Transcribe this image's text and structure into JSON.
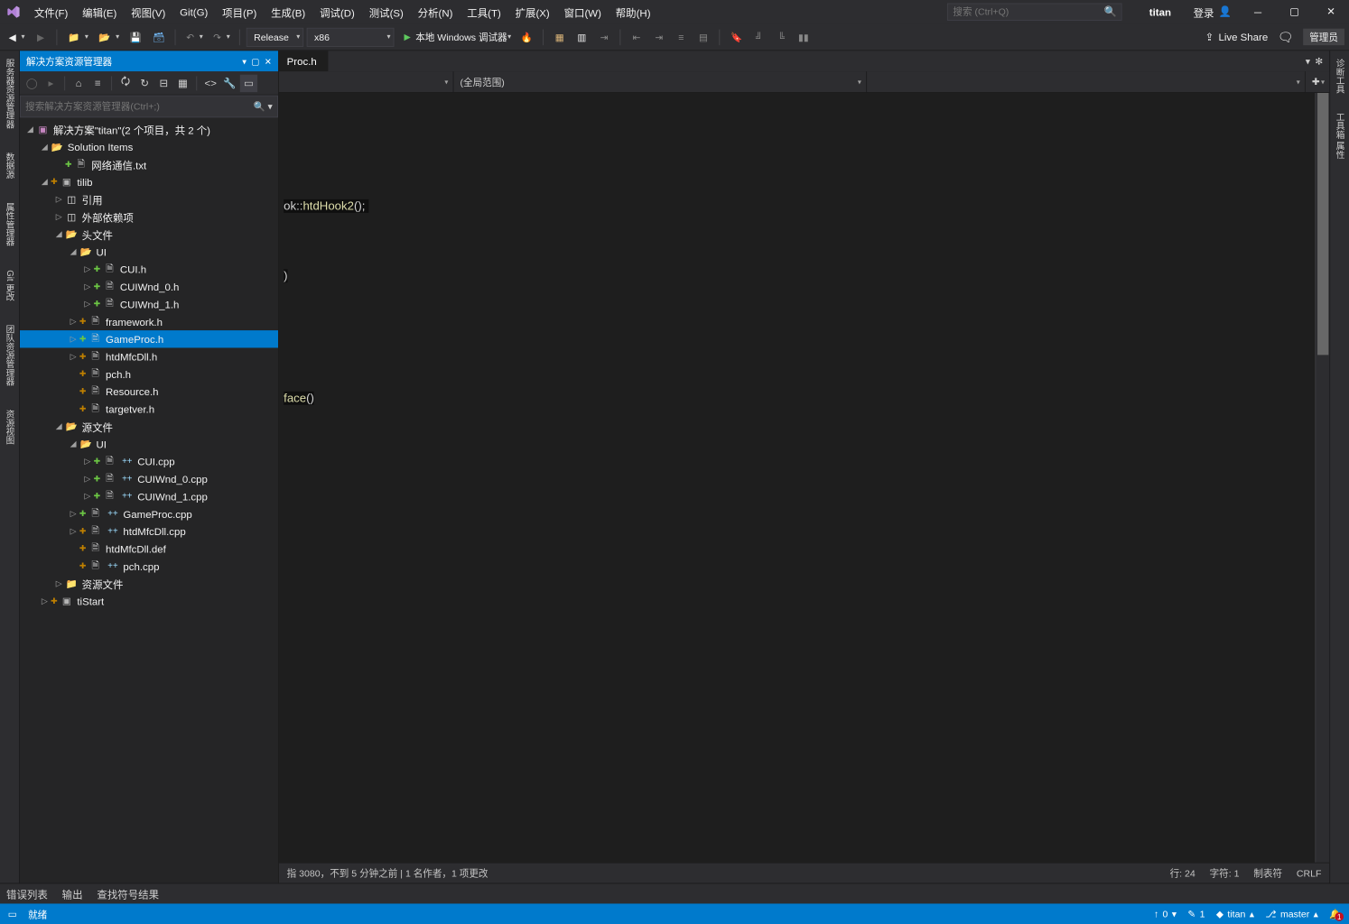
{
  "menu": [
    "文件(F)",
    "编辑(E)",
    "视图(V)",
    "Git(G)",
    "项目(P)",
    "生成(B)",
    "调试(D)",
    "测试(S)",
    "分析(N)",
    "工具(T)",
    "扩展(X)",
    "窗口(W)",
    "帮助(H)"
  ],
  "search_placeholder": "搜索 (Ctrl+Q)",
  "project_name": "titan",
  "login": "登录",
  "admin_badge": "管理员",
  "live_share": "Live Share",
  "config": "Release",
  "platform": "x86",
  "debugger_label": "本地 Windows 调试器",
  "left_tabs": [
    "服务器资源管理器",
    "数据源",
    "属性管理器",
    "Git 更改",
    "团队资源管理器",
    "资源视图"
  ],
  "right_tabs": [
    "诊断工具",
    "工具箱 属性"
  ],
  "sln_panel": {
    "title": "解决方案资源管理器",
    "search_ph": "搜索解决方案资源管理器(Ctrl+;)",
    "tree": [
      {
        "d": 0,
        "tw": "open",
        "ic": "sln",
        "lbl": "解决方案\"titan\"(2 个项目，共 2 个)"
      },
      {
        "d": 1,
        "tw": "open",
        "ic": "folder",
        "lbl": "Solution Items"
      },
      {
        "d": 2,
        "tw": "none",
        "ic": "file",
        "git": "add",
        "lbl": "网络通信.txt"
      },
      {
        "d": 1,
        "tw": "open",
        "ic": "proj",
        "git": "mod",
        "lbl": "tilib"
      },
      {
        "d": 2,
        "tw": "closed",
        "ic": "ref",
        "lbl": "引用"
      },
      {
        "d": 2,
        "tw": "closed",
        "ic": "ref",
        "lbl": "外部依赖项"
      },
      {
        "d": 2,
        "tw": "open",
        "ic": "folder",
        "lbl": "头文件"
      },
      {
        "d": 3,
        "tw": "open",
        "ic": "folder",
        "lbl": "UI"
      },
      {
        "d": 4,
        "tw": "closed",
        "ic": "file",
        "git": "add",
        "lbl": "CUI.h"
      },
      {
        "d": 4,
        "tw": "closed",
        "ic": "file",
        "git": "add",
        "lbl": "CUIWnd_0.h"
      },
      {
        "d": 4,
        "tw": "closed",
        "ic": "file",
        "git": "add",
        "lbl": "CUIWnd_1.h"
      },
      {
        "d": 3,
        "tw": "closed",
        "ic": "file",
        "git": "mod",
        "lbl": "framework.h"
      },
      {
        "d": 3,
        "tw": "closed",
        "ic": "file",
        "git": "add",
        "lbl": "GameProc.h",
        "sel": true
      },
      {
        "d": 3,
        "tw": "closed",
        "ic": "file",
        "git": "mod",
        "lbl": "htdMfcDll.h"
      },
      {
        "d": 3,
        "tw": "none",
        "ic": "file",
        "git": "mod",
        "lbl": "pch.h"
      },
      {
        "d": 3,
        "tw": "none",
        "ic": "file",
        "git": "mod",
        "lbl": "Resource.h"
      },
      {
        "d": 3,
        "tw": "none",
        "ic": "file",
        "git": "mod",
        "lbl": "targetver.h"
      },
      {
        "d": 2,
        "tw": "open",
        "ic": "folder",
        "lbl": "源文件"
      },
      {
        "d": 3,
        "tw": "open",
        "ic": "folder",
        "lbl": "UI"
      },
      {
        "d": 4,
        "tw": "closed",
        "ic": "file",
        "git": "add",
        "cpp": true,
        "lbl": "CUI.cpp"
      },
      {
        "d": 4,
        "tw": "closed",
        "ic": "file",
        "git": "add",
        "cpp": true,
        "lbl": "CUIWnd_0.cpp"
      },
      {
        "d": 4,
        "tw": "closed",
        "ic": "file",
        "git": "add",
        "cpp": true,
        "lbl": "CUIWnd_1.cpp"
      },
      {
        "d": 3,
        "tw": "closed",
        "ic": "file",
        "git": "add",
        "cpp": true,
        "lbl": "GameProc.cpp"
      },
      {
        "d": 3,
        "tw": "closed",
        "ic": "file",
        "git": "mod",
        "cpp": true,
        "lbl": "htdMfcDll.cpp"
      },
      {
        "d": 3,
        "tw": "none",
        "ic": "file",
        "git": "mod",
        "lbl": "htdMfcDll.def"
      },
      {
        "d": 3,
        "tw": "none",
        "ic": "file",
        "git": "mod",
        "cpp": true,
        "lbl": "pch.cpp"
      },
      {
        "d": 2,
        "tw": "closed",
        "ic": "folder-closed",
        "lbl": "资源文件"
      },
      {
        "d": 1,
        "tw": "closed",
        "ic": "proj",
        "git": "mod",
        "lbl": "tiStart"
      }
    ]
  },
  "editor": {
    "tab": "Proc.h",
    "nav_scope": "(全局范围)",
    "code_line1_a": "ok::",
    "code_line1_b": "htdHook2",
    "code_line1_c": "();",
    "code_line2": ")",
    "code_line3_a": "face",
    "code_line3_b": "()",
    "status_left": "指 3080，不到 5 分钟之前 | 1 名作者，1 项更改",
    "status_ln": "行: 24",
    "status_ch": "字符: 1",
    "status_tab": "制表符",
    "status_eol": "CRLF"
  },
  "bottom_tabs": [
    "错误列表",
    "输出",
    "查找符号结果"
  ],
  "statusbar": {
    "ready": "就绪",
    "up": "0",
    "pen": "1",
    "repo": "titan",
    "branch": "master",
    "bell": "1"
  }
}
